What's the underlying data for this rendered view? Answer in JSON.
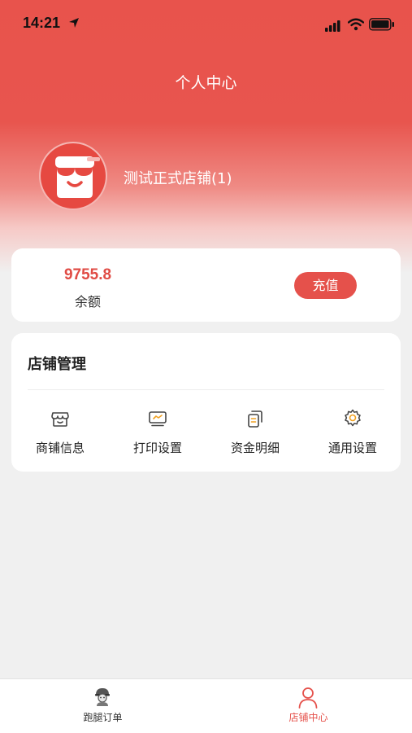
{
  "status_bar": {
    "time": "14:21"
  },
  "header": {
    "title": "个人中心"
  },
  "profile": {
    "store_name": "测试正式店铺(1)"
  },
  "balance": {
    "amount": "9755.8",
    "label": "余额",
    "recharge_label": "充值"
  },
  "management": {
    "title": "店铺管理",
    "items": [
      {
        "label": "商铺信息",
        "icon": "store-icon"
      },
      {
        "label": "打印设置",
        "icon": "printer-monitor-icon"
      },
      {
        "label": "资金明细",
        "icon": "documents-icon"
      },
      {
        "label": "通用设置",
        "icon": "gear-icon"
      }
    ]
  },
  "tabbar": {
    "items": [
      {
        "label": "跑腿订单",
        "icon": "courier-icon",
        "active": false
      },
      {
        "label": "店铺中心",
        "icon": "person-icon",
        "active": true
      }
    ]
  },
  "colors": {
    "accent": "#e5514b",
    "amount": "#e04b44",
    "background": "#f0f0f0"
  }
}
